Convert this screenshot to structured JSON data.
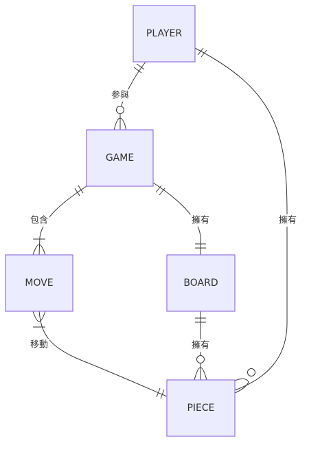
{
  "entities": {
    "player": "PLAYER",
    "game": "GAME",
    "move": "MOVE",
    "board": "BOARD",
    "piece": "PIECE"
  },
  "relationships": [
    {
      "from": "PLAYER",
      "to": "GAME",
      "label": "参與",
      "from_card": "exactly-one",
      "to_card": "zero-or-more"
    },
    {
      "from": "GAME",
      "to": "MOVE",
      "label": "包含",
      "from_card": "exactly-one",
      "to_card": "one-or-more"
    },
    {
      "from": "GAME",
      "to": "BOARD",
      "label": "擁有",
      "from_card": "exactly-one",
      "to_card": "exactly-one"
    },
    {
      "from": "PLAYER",
      "to": "PIECE",
      "label": "擁有",
      "from_card": "exactly-one",
      "to_card": "zero-or-more"
    },
    {
      "from": "BOARD",
      "to": "PIECE",
      "label": "擁有",
      "from_card": "exactly-one",
      "to_card": "zero-or-more"
    },
    {
      "from": "MOVE",
      "to": "PIECE",
      "label": "移動",
      "from_card": "one-or-more",
      "to_card": "exactly-one"
    }
  ],
  "colors": {
    "entity_fill": "#ececff",
    "entity_stroke": "#9370db",
    "line": "#333333",
    "text": "#333333"
  }
}
